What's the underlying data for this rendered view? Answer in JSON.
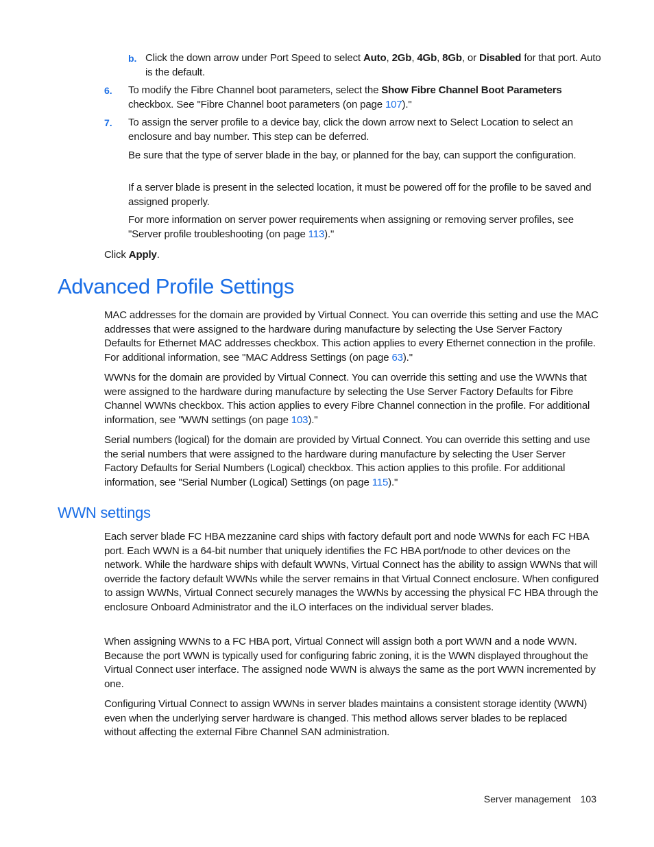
{
  "steps": {
    "b": {
      "marker": "b.",
      "pre": "Click the down arrow under Port Speed to select ",
      "opt1": "Auto",
      "sep1": ", ",
      "opt2": "2Gb",
      "sep2": ", ",
      "opt3": "4Gb",
      "sep3": ", ",
      "opt4": "8Gb",
      "sep4": ", or ",
      "opt5": "Disabled",
      "post": " for that port. Auto is the default."
    },
    "s6": {
      "marker": "6.",
      "pre": "To modify the Fibre Channel boot parameters, select the ",
      "bold": "Show Fibre Channel Boot Parameters",
      "mid": " checkbox. See \"Fibre Channel boot parameters (on page ",
      "link": "107",
      "post": ").\""
    },
    "s7": {
      "marker": "7.",
      "text": "To assign the server profile to a device bay, click the down arrow next to Select Location to select an enclosure and bay number. This step can be deferred.",
      "p1": "Be sure that the type of server blade in the bay, or planned for the bay, can support the configuration.",
      "p2": "If a server blade is present in the selected location, it must be powered off for the profile to be saved and assigned properly.",
      "p3_pre": "For more information on server power requirements when assigning or removing server profiles, see \"Server profile troubleshooting (on page ",
      "p3_link": "113",
      "p3_post": ").\""
    },
    "apply": {
      "pre": "Click ",
      "bold": "Apply",
      "post": "."
    }
  },
  "section1": {
    "title": "Advanced Profile Settings",
    "p1_pre": "MAC addresses for the domain are provided by Virtual Connect. You can override this setting and use the MAC addresses that were assigned to the hardware during manufacture by selecting the Use Server Factory Defaults for Ethernet MAC addresses checkbox. This action applies to every Ethernet connection in the profile. For additional information, see \"MAC Address Settings (on page ",
    "p1_link": "63",
    "p1_post": ").\"",
    "p2_pre": "WWNs for the domain are provided by Virtual Connect. You can override this setting and use the WWNs that were assigned to the hardware during manufacture by selecting the Use Server Factory Defaults for Fibre Channel WWNs checkbox. This action applies to every Fibre Channel connection in the profile. For additional information, see \"WWN settings (on page ",
    "p2_link": "103",
    "p2_post": ").\"",
    "p3_pre": "Serial numbers (logical) for the domain are provided by Virtual Connect. You can override this setting and use the serial numbers that were assigned to the hardware during manufacture by selecting the User Server Factory Defaults for Serial Numbers (Logical) checkbox. This action applies to this profile. For additional information, see \"Serial Number (Logical) Settings (on page ",
    "p3_link": "115",
    "p3_post": ").\""
  },
  "section2": {
    "title": "WWN settings",
    "p1": "Each server blade FC HBA mezzanine card ships with factory default port and node WWNs for each FC HBA port. Each WWN is a 64-bit number that uniquely identifies the FC HBA port/node to other devices on the network. While the hardware ships with default WWNs, Virtual Connect has the ability to assign WWNs that will override the factory default WWNs while the server remains in that Virtual Connect enclosure. When configured to assign WWNs, Virtual Connect securely manages the WWNs by accessing the physical FC HBA through the enclosure Onboard Administrator and the iLO interfaces on the individual server blades.",
    "p2": "When assigning WWNs to a FC HBA port, Virtual Connect will assign both a port WWN and a node WWN. Because the port WWN is typically used for configuring fabric zoning, it is the WWN displayed throughout the Virtual Connect user interface. The assigned node WWN is always the same as the port WWN incremented by one.",
    "p3": "Configuring Virtual Connect to assign WWNs in server blades maintains a consistent storage identity (WWN) even when the underlying server hardware is changed. This method allows server blades to be replaced without affecting the external Fibre Channel SAN administration."
  },
  "footer": {
    "section": "Server management",
    "page": "103"
  },
  "colors": {
    "accent": "#1a6ee6",
    "text": "#1a1a1a"
  }
}
